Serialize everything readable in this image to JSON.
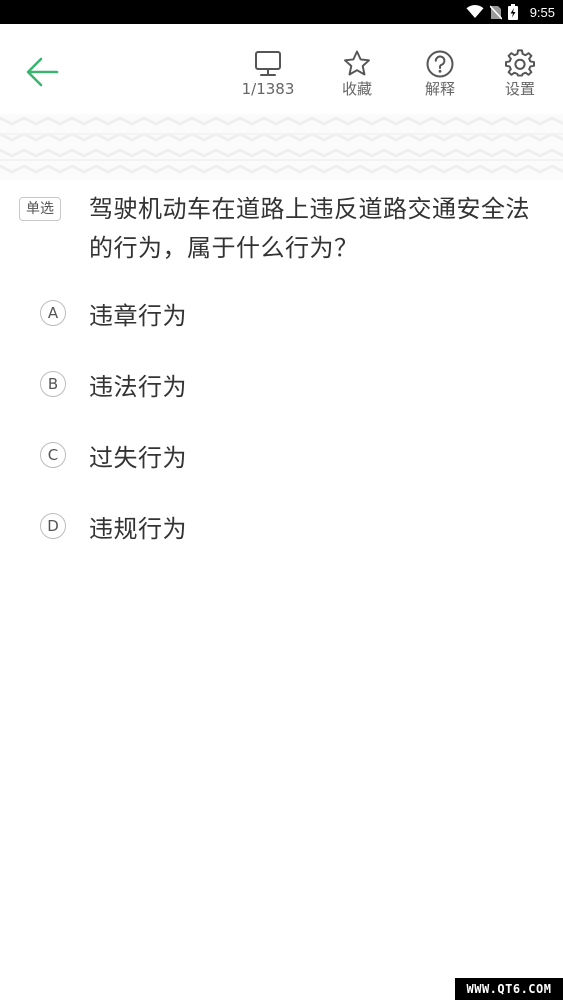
{
  "status_bar": {
    "time": "9:55",
    "icons": [
      "wifi-icon",
      "no-sim-icon",
      "battery-charging-icon"
    ]
  },
  "toolbar": {
    "back_icon": "arrow-left-icon",
    "accent_color": "#3cb371",
    "progress": {
      "icon": "monitor-icon",
      "label": "1/1383"
    },
    "favorite": {
      "icon": "star-icon",
      "label": "收藏"
    },
    "explain": {
      "icon": "question-circle-icon",
      "label": "解释"
    },
    "settings": {
      "icon": "gear-icon",
      "label": "设置"
    }
  },
  "question": {
    "type": "单选",
    "text": "驾驶机动车在道路上违反道路交通安全法的行为，属于什么行为？"
  },
  "options": [
    {
      "letter": "A",
      "text": "违章行为"
    },
    {
      "letter": "B",
      "text": "违法行为"
    },
    {
      "letter": "C",
      "text": "过失行为"
    },
    {
      "letter": "D",
      "text": "违规行为"
    }
  ],
  "watermark": "WWW.QT6.COM"
}
